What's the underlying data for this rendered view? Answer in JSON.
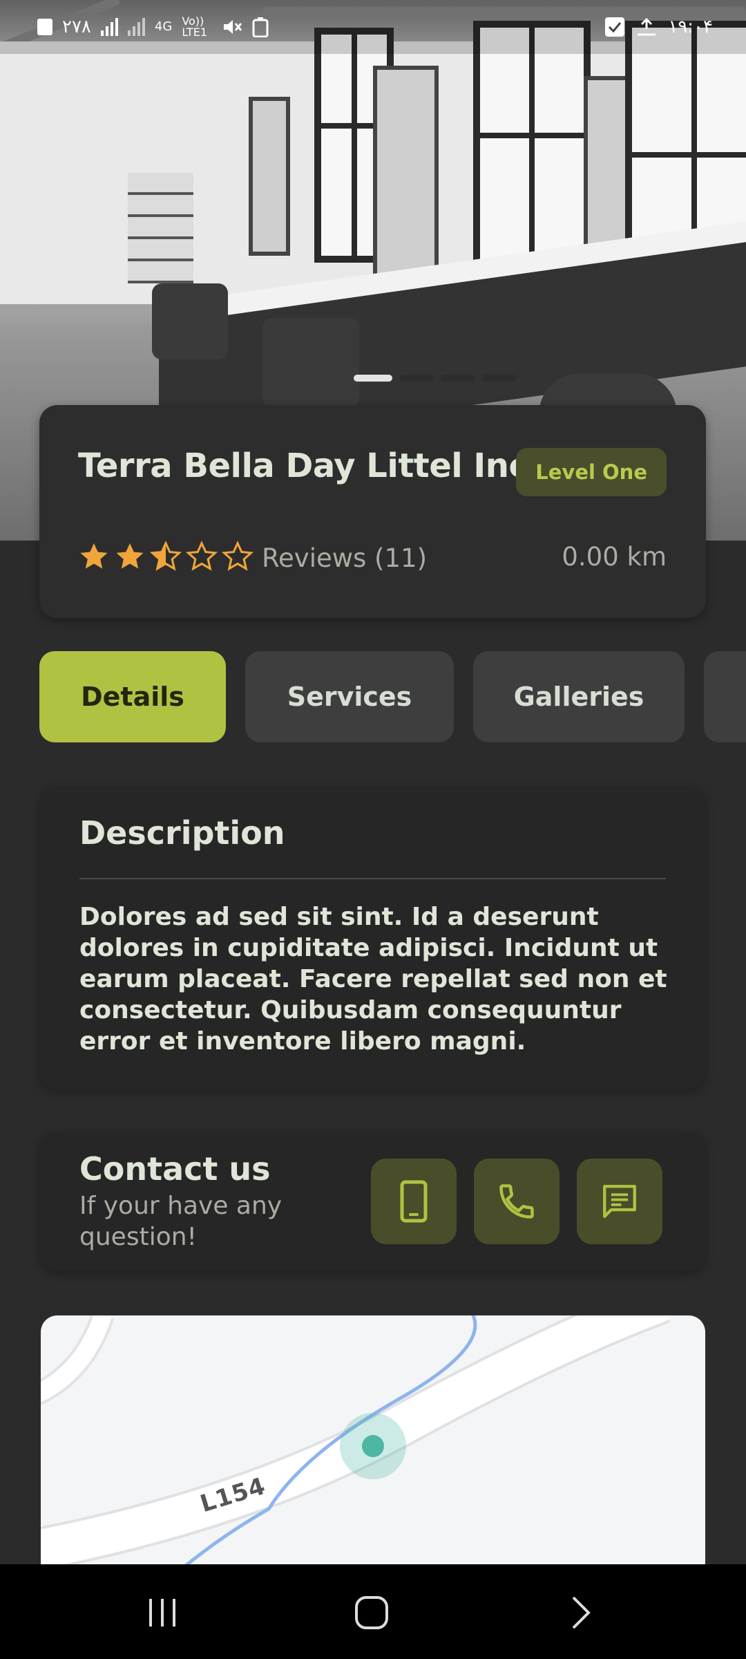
{
  "status_bar": {
    "left_text": "۲۷۸",
    "network": "4G",
    "volte": "Vo)) LTE1",
    "time": "۱۹:۰۴"
  },
  "hero": {
    "image_desc_icon": "salon-photo",
    "carousel": {
      "count": 4,
      "active_index": 0
    }
  },
  "shop": {
    "name": "Terra Bella Day Littel Inc",
    "level": "Level One",
    "rating": 2.5,
    "max_rating": 5,
    "reviews_label": "Reviews (11)",
    "distance": "0.00 km"
  },
  "tabs": [
    {
      "label": "Details",
      "active": true
    },
    {
      "label": "Services",
      "active": false
    },
    {
      "label": "Galleries",
      "active": false
    },
    {
      "label": "",
      "active": false
    }
  ],
  "description": {
    "title": "Description",
    "text": "Dolores ad sed sit sint. Id a deserunt dolores in cupiditate adipisci. Incidunt ut earum placeat. Facere repellat sed non et consectetur. Quibusdam consequuntur error et inventore libero magni."
  },
  "contact": {
    "title": "Contact us",
    "subtitle": "If your have any question!",
    "buttons": [
      "mobile-phone-icon",
      "phone-call-icon",
      "message-icon"
    ]
  },
  "map": {
    "road_label": "L154"
  },
  "colors": {
    "background": "#2b2b2b",
    "card": "#2d2d2d",
    "accent": "#b1c243",
    "accent_dark": "#494d2a",
    "star": "#f0a53b",
    "map_marker": "#4db6a4"
  }
}
